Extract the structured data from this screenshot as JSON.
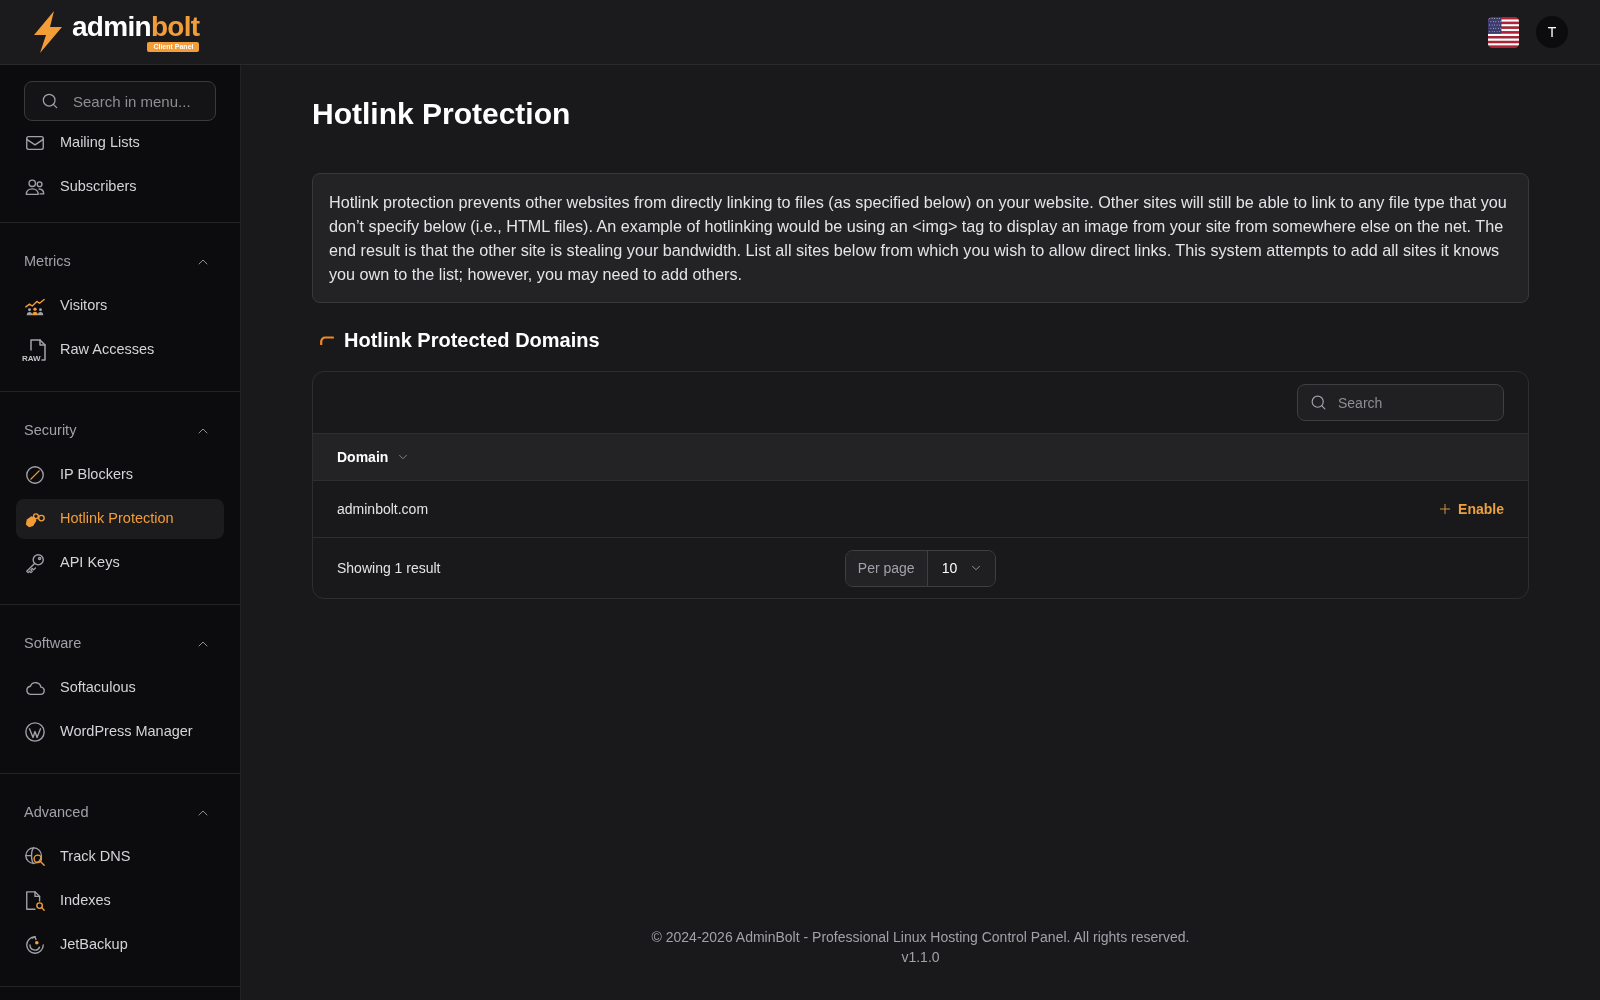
{
  "top_bar": {
    "logo": {
      "wordmark": [
        {
          "text": "admin",
          "accent": false
        },
        {
          "text": "bolt",
          "accent": true
        }
      ],
      "badge": "Client Panel"
    },
    "avatar": {
      "initial": "T"
    }
  },
  "sidebar": {
    "search": {
      "placeholder": "Search in menu..."
    },
    "sections": [
      {
        "items": [
          {
            "label": "Mailing Lists",
            "selected": false
          },
          {
            "label": "Subscribers",
            "selected": false
          }
        ]
      },
      {
        "title": "Metrics",
        "expanded": true,
        "items": [
          {
            "label": "Visitors",
            "selected": false
          },
          {
            "label": "Raw Accesses",
            "selected": false,
            "icon_label": "RAW"
          }
        ]
      },
      {
        "title": "Security",
        "expanded": true,
        "items": [
          {
            "label": "IP Blockers",
            "selected": false
          },
          {
            "label": "Hotlink Protection",
            "selected": true
          },
          {
            "label": "API Keys",
            "selected": false
          }
        ]
      },
      {
        "title": "Software",
        "expanded": true,
        "items": [
          {
            "label": "Softaculous",
            "selected": false
          },
          {
            "label": "WordPress Manager",
            "selected": false
          }
        ]
      },
      {
        "title": "Advanced",
        "expanded": true,
        "items": [
          {
            "label": "Track DNS",
            "selected": false
          },
          {
            "label": "Indexes",
            "selected": false
          },
          {
            "label": "JetBackup",
            "selected": false
          }
        ]
      }
    ]
  },
  "page": {
    "title": "Hotlink Protection",
    "description": "Hotlink protection prevents other websites from directly linking to files (as specified below) on your website. Other sites will still be able to link to any file type that you don’t specify below (i.e., HTML files). An example of hotlinking would be using an <img> tag to display an image from your site from somewhere else on the net. The end result is that the other site is stealing your bandwidth. List all sites below from which you wish to allow direct links. This system attempts to add all sites it knows you own to the list; however, you may need to add others.",
    "section_title": "Hotlink Protected Domains",
    "table": {
      "search": {
        "placeholder": "Search"
      },
      "columns": [
        {
          "label": "Domain"
        }
      ],
      "rows": [
        {
          "domain": "adminbolt.com",
          "action": "Enable"
        }
      ],
      "summary": "Showing 1 result",
      "per_page": {
        "label": "Per page",
        "value": "10"
      }
    }
  },
  "footer": {
    "copyright": "© 2024-2026 AdminBolt - Professional Linux Hosting Control Panel. All rights reserved.",
    "version": "v1.1.0"
  }
}
